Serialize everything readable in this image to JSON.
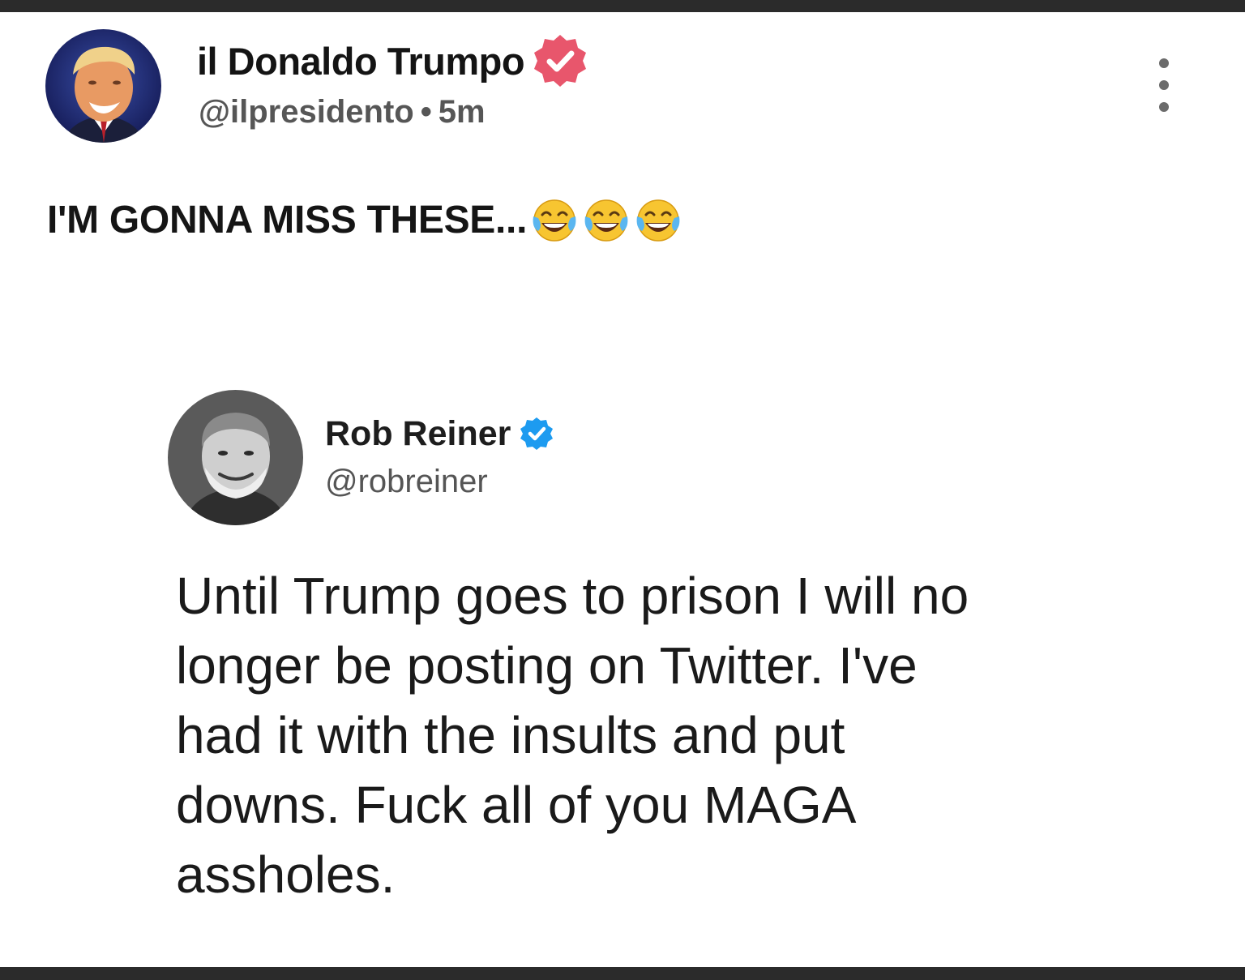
{
  "post": {
    "author": {
      "display_name": "il Donaldo Trumpo",
      "handle": "@ilpresidento",
      "separator": "•",
      "time": "5m",
      "verified_badge_color": "#e8566c",
      "avatar_icon": "person-avatar"
    },
    "menu_icon": "more-vertical-icon",
    "text": "I'M GONNA MISS THESE...",
    "emoji": [
      "face-with-tears-of-joy",
      "face-with-tears-of-joy",
      "face-with-tears-of-joy"
    ]
  },
  "embedded_tweet": {
    "author": {
      "display_name": "Rob Reiner",
      "handle": "@robreiner",
      "verified_badge_color": "#1d9bf0",
      "avatar_icon": "person-avatar-grayscale"
    },
    "text_lines": [
      "Until Trump goes to prison I will no",
      "longer be posting on Twitter. I've",
      "had it with the insults and put",
      "downs. Fuck all of you MAGA",
      "assholes."
    ]
  },
  "colors": {
    "frame": "#2b2b2b",
    "background": "#ffffff",
    "text_primary": "#141414",
    "text_secondary": "#565656"
  }
}
